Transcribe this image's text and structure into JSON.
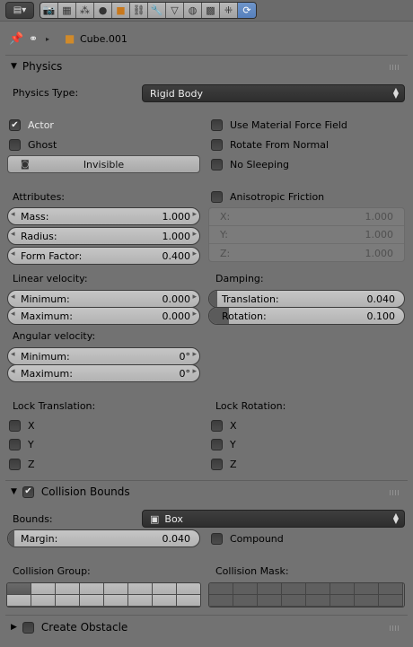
{
  "header": {
    "view_menu_icon": "editor-type-icon",
    "context_tabs": [
      "render-icon",
      "render-layers-icon",
      "scene-icon",
      "world-icon",
      "object-icon",
      "constraint-icon",
      "modifier-icon",
      "data-icon",
      "material-icon",
      "texture-icon",
      "particles-icon",
      "physics-icon"
    ],
    "active_tab": "physics-icon"
  },
  "breadcrumb": {
    "object_name": "Cube.001"
  },
  "physics": {
    "title": "Physics",
    "type_label": "Physics Type:",
    "type_value": "Rigid Body",
    "actor": "Actor",
    "ghost": "Ghost",
    "invisible": "Invisible",
    "use_material_force_field": "Use Material Force Field",
    "rotate_from_normal": "Rotate From Normal",
    "no_sleeping": "No Sleeping",
    "attributes_label": "Attributes:",
    "mass_label": "Mass:",
    "mass_value": "1.000",
    "radius_label": "Radius:",
    "radius_value": "1.000",
    "form_factor_label": "Form Factor:",
    "form_factor_value": "0.400",
    "anisotropic_friction": "Anisotropic Friction",
    "aniso_x_label": "X:",
    "aniso_x_value": "1.000",
    "aniso_y_label": "Y:",
    "aniso_y_value": "1.000",
    "aniso_z_label": "Z:",
    "aniso_z_value": "1.000",
    "linear_velocity_label": "Linear velocity:",
    "lin_min_label": "Minimum:",
    "lin_min_value": "0.000",
    "lin_max_label": "Maximum:",
    "lin_max_value": "0.000",
    "damping_label": "Damping:",
    "damp_translation_label": "Translation:",
    "damp_translation_value": "0.040",
    "damp_rotation_label": "Rotation:",
    "damp_rotation_value": "0.100",
    "angular_velocity_label": "Angular velocity:",
    "ang_min_label": "Minimum:",
    "ang_min_value": "0°",
    "ang_max_label": "Maximum:",
    "ang_max_value": "0°",
    "lock_translation_label": "Lock Translation:",
    "lock_rotation_label": "Lock Rotation:",
    "x": "X",
    "y": "Y",
    "z": "Z"
  },
  "collision": {
    "title": "Collision Bounds",
    "bounds_label": "Bounds:",
    "bounds_value": "Box",
    "margin_label": "Margin:",
    "margin_value": "0.040",
    "compound": "Compound",
    "group_label": "Collision Group:",
    "mask_label": "Collision Mask:"
  },
  "obstacle": {
    "title": "Create Obstacle"
  }
}
